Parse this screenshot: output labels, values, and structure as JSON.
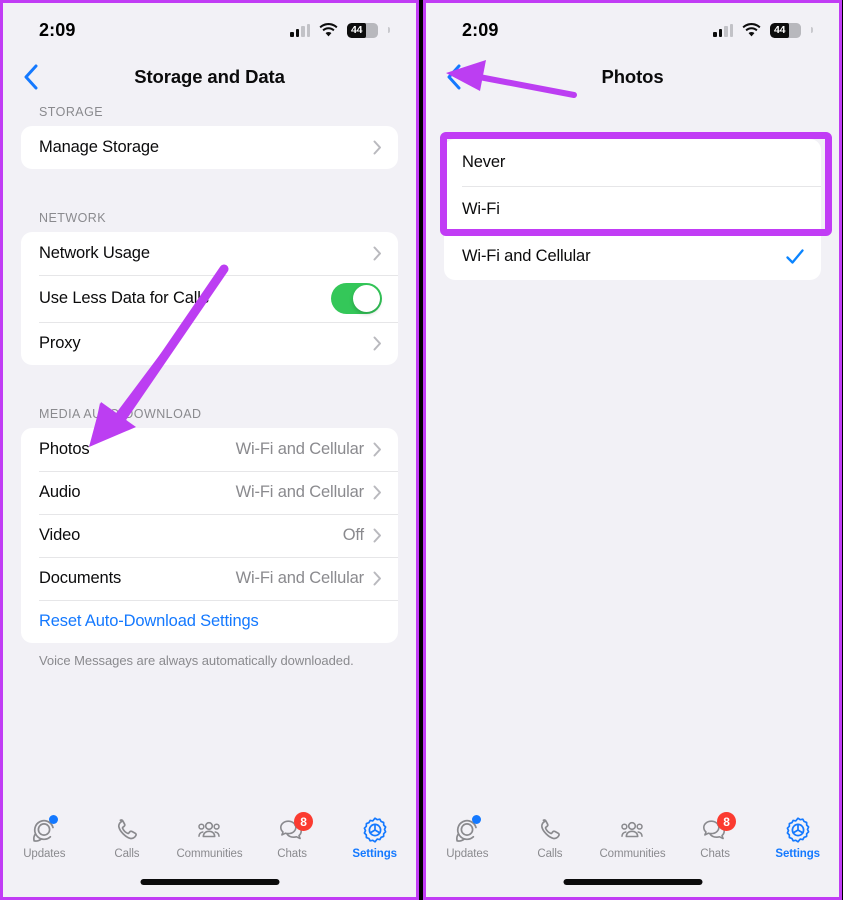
{
  "status_bar": {
    "time": "2:09",
    "battery_level": "44",
    "cell_icon": "cellular-signal-icon",
    "wifi_icon": "wifi-icon",
    "battery_icon": "battery-icon"
  },
  "accent": {
    "annotation_purple": "#c13cf5",
    "ios_blue": "#1479ff",
    "toggle_green": "#34c759",
    "badge_red": "#fb3b30",
    "secondary_gray": "#8a8a8e"
  },
  "left_panel": {
    "nav": {
      "title": "Storage and Data",
      "back_icon": "chevron-left-icon"
    },
    "sections": [
      {
        "header": "STORAGE",
        "rows": [
          {
            "label": "Manage Storage",
            "value": "",
            "accessory": "chevron"
          }
        ]
      },
      {
        "header": "NETWORK",
        "rows": [
          {
            "label": "Network Usage",
            "value": "",
            "accessory": "chevron"
          },
          {
            "label": "Use Less Data for Calls",
            "value": "",
            "accessory": "toggle-on"
          },
          {
            "label": "Proxy",
            "value": "",
            "accessory": "chevron"
          }
        ]
      },
      {
        "header": "MEDIA AUTO-DOWNLOAD",
        "rows": [
          {
            "label": "Photos",
            "value": "Wi-Fi and Cellular",
            "accessory": "chevron"
          },
          {
            "label": "Audio",
            "value": "Wi-Fi and Cellular",
            "accessory": "chevron"
          },
          {
            "label": "Video",
            "value": "Off",
            "accessory": "chevron"
          },
          {
            "label": "Documents",
            "value": "Wi-Fi and Cellular",
            "accessory": "chevron"
          },
          {
            "label": "Reset Auto-Download Settings",
            "value": "",
            "accessory": "none"
          }
        ],
        "footnote": "Voice Messages are always automatically downloaded."
      }
    ]
  },
  "right_panel": {
    "nav": {
      "title": "Photos",
      "back_icon": "chevron-left-icon"
    },
    "options": [
      {
        "label": "Never",
        "selected": false
      },
      {
        "label": "Wi-Fi",
        "selected": false
      },
      {
        "label": "Wi-Fi and Cellular",
        "selected": true
      }
    ]
  },
  "tab_bar": {
    "items": [
      {
        "label": "Updates",
        "icon": "updates-icon",
        "active": false,
        "dot": true,
        "badge": ""
      },
      {
        "label": "Calls",
        "icon": "calls-icon",
        "active": false,
        "dot": false,
        "badge": ""
      },
      {
        "label": "Communities",
        "icon": "communities-icon",
        "active": false,
        "dot": false,
        "badge": ""
      },
      {
        "label": "Chats",
        "icon": "chats-icon",
        "active": false,
        "dot": false,
        "badge": "8"
      },
      {
        "label": "Settings",
        "icon": "settings-gear-icon",
        "active": true,
        "dot": false,
        "badge": ""
      }
    ]
  },
  "annotations": {
    "left_arrow": "purple-arrow-pointing-to-photos-row",
    "right_arrow": "purple-arrow-pointing-to-back-button",
    "highlight_box": "purple-box-around-never-and-wifi-options"
  }
}
